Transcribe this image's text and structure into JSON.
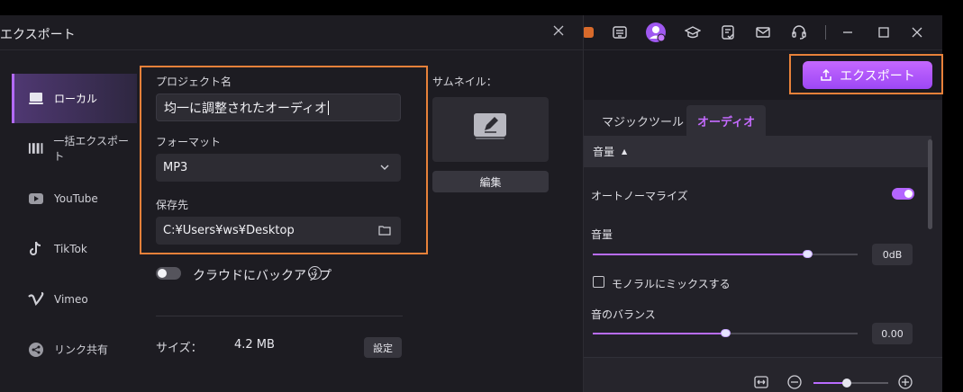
{
  "dialog": {
    "title": "エクスポート",
    "sidebar": [
      {
        "label": "ローカル",
        "icon": "computer-icon",
        "active": true
      },
      {
        "label": "一括エクスポート",
        "icon": "batch-icon",
        "active": false
      },
      {
        "label": "YouTube",
        "icon": "youtube-icon",
        "active": false
      },
      {
        "label": "TikTok",
        "icon": "tiktok-icon",
        "active": false
      },
      {
        "label": "Vimeo",
        "icon": "vimeo-icon",
        "active": false
      },
      {
        "label": "リンク共有",
        "icon": "share-icon",
        "active": false
      }
    ],
    "project_name_label": "プロジェクト名",
    "project_name_value": "均一に調整されたオーディオ",
    "format_label": "フォーマット",
    "format_value": "MP3",
    "save_label": "保存先",
    "save_path": "C:¥Users¥ws¥Desktop",
    "cloud_backup_label": "クラウドにバックアップ",
    "cloud_backup_on": false,
    "size_label": "サイズ：",
    "size_value": "4.2 MB",
    "settings_button": "設定",
    "thumbnail_label": "サムネイル：",
    "edit_button": "編集"
  },
  "editor": {
    "export_button": "エクスポート",
    "tabs": [
      {
        "label": "マジックツール",
        "active": false
      },
      {
        "label": "オーディオ",
        "active": true
      }
    ],
    "volume_section": "音量",
    "normalize_label": "オートノーマライズ",
    "normalize_on": true,
    "volume_label": "音量",
    "volume_value": "0dB",
    "volume_level": 0.81,
    "mono_label": "モノラルにミックスする",
    "mono_checked": false,
    "balance_label": "音のバランス",
    "balance_value": "0.00",
    "balance_level": 0.5,
    "zoom_level": 0.45
  },
  "colors": {
    "accent": "#b36aff",
    "highlight": "#e8813a",
    "background": "#1d1c22"
  }
}
